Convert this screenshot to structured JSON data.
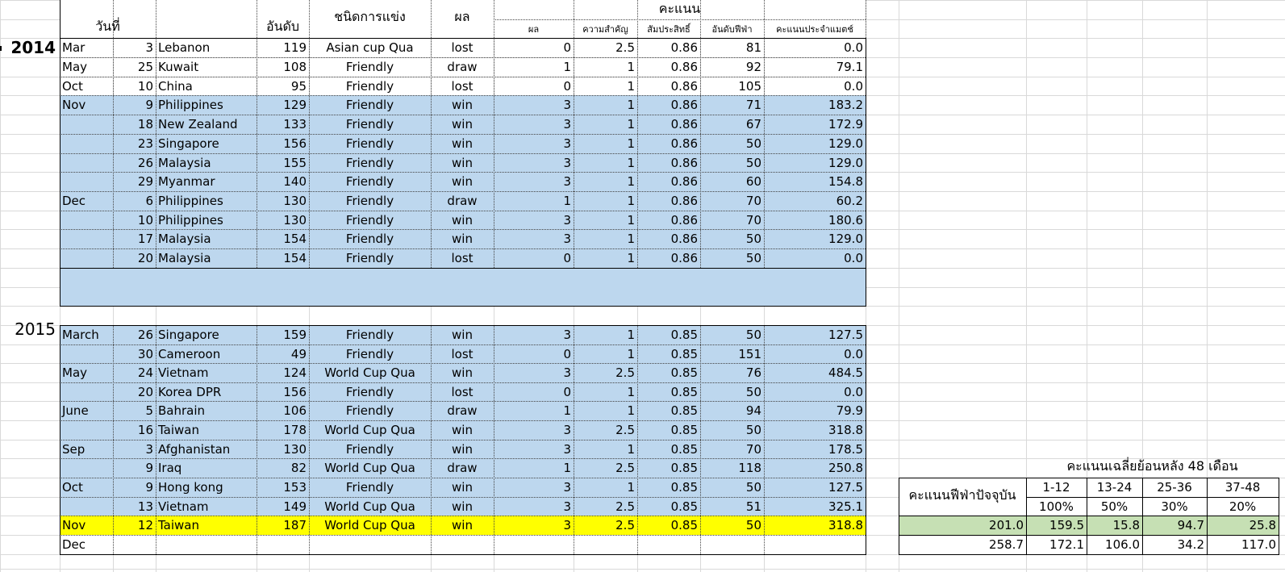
{
  "header": {
    "day": "วันที่",
    "rank": "อันดับ",
    "competition": "ชนิดการแข่ง",
    "result": "ผล",
    "points": "คะแนน",
    "sub": [
      "ผล",
      "ความสำคัญ",
      "สัมประสิทธิ์",
      "อันดับฟีฟ่า",
      "คะแนนประจำแมตช์"
    ]
  },
  "years": [
    "2014",
    "2015"
  ],
  "rows2014": [
    [
      "Mar",
      "3",
      "Lebanon",
      "119",
      "Asian cup Qua",
      "lost",
      "0",
      "2.5",
      "0.86",
      "81",
      "0.0"
    ],
    [
      "May",
      "25",
      "Kuwait",
      "108",
      "Friendly",
      "draw",
      "1",
      "1",
      "0.86",
      "92",
      "79.1"
    ],
    [
      "Oct",
      "10",
      "China",
      "95",
      "Friendly",
      "lost",
      "0",
      "1",
      "0.86",
      "105",
      "0.0"
    ],
    [
      "Nov",
      "9",
      "Philippines",
      "129",
      "Friendly",
      "win",
      "3",
      "1",
      "0.86",
      "71",
      "183.2"
    ],
    [
      "",
      "18",
      "New Zealand",
      "133",
      "Friendly",
      "win",
      "3",
      "1",
      "0.86",
      "67",
      "172.9"
    ],
    [
      "",
      "23",
      "Singapore",
      "156",
      "Friendly",
      "win",
      "3",
      "1",
      "0.86",
      "50",
      "129.0"
    ],
    [
      "",
      "26",
      "Malaysia",
      "155",
      "Friendly",
      "win",
      "3",
      "1",
      "0.86",
      "50",
      "129.0"
    ],
    [
      "",
      "29",
      "Myanmar",
      "140",
      "Friendly",
      "win",
      "3",
      "1",
      "0.86",
      "60",
      "154.8"
    ],
    [
      "Dec",
      "6",
      "Philippines",
      "130",
      "Friendly",
      "draw",
      "1",
      "1",
      "0.86",
      "70",
      "60.2"
    ],
    [
      "",
      "10",
      "Philippines",
      "130",
      "Friendly",
      "win",
      "3",
      "1",
      "0.86",
      "70",
      "180.6"
    ],
    [
      "",
      "17",
      "Malaysia",
      "154",
      "Friendly",
      "win",
      "3",
      "1",
      "0.86",
      "50",
      "129.0"
    ],
    [
      "",
      "20",
      "Malaysia",
      "154",
      "Friendly",
      "lost",
      "0",
      "1",
      "0.86",
      "50",
      "0.0"
    ]
  ],
  "rows2015": [
    [
      "March",
      "26",
      "Singapore",
      "159",
      "Friendly",
      "win",
      "3",
      "1",
      "0.85",
      "50",
      "127.5"
    ],
    [
      "",
      "30",
      "Cameroon",
      "49",
      "Friendly",
      "lost",
      "0",
      "1",
      "0.85",
      "151",
      "0.0"
    ],
    [
      "May",
      "24",
      "Vietnam",
      "124",
      "World Cup Qua",
      "win",
      "3",
      "2.5",
      "0.85",
      "76",
      "484.5"
    ],
    [
      "",
      "20",
      "Korea DPR",
      "156",
      "Friendly",
      "lost",
      "0",
      "1",
      "0.85",
      "50",
      "0.0"
    ],
    [
      "June",
      "5",
      "Bahrain",
      "106",
      "Friendly",
      "draw",
      "1",
      "1",
      "0.85",
      "94",
      "79.9"
    ],
    [
      "",
      "16",
      "Taiwan",
      "178",
      "World Cup Qua",
      "win",
      "3",
      "2.5",
      "0.85",
      "50",
      "318.8"
    ],
    [
      "Sep",
      "3",
      "Afghanistan",
      "130",
      "Friendly",
      "win",
      "3",
      "1",
      "0.85",
      "70",
      "178.5"
    ],
    [
      "",
      "9",
      "Iraq",
      "82",
      "World Cup Qua",
      "draw",
      "1",
      "2.5",
      "0.85",
      "118",
      "250.8"
    ],
    [
      "Oct",
      "9",
      "Hong kong",
      "153",
      "Friendly",
      "win",
      "3",
      "1",
      "0.85",
      "50",
      "127.5"
    ],
    [
      "",
      "13",
      "Vietnam",
      "149",
      "World Cup Qua",
      "win",
      "3",
      "2.5",
      "0.85",
      "51",
      "325.1"
    ],
    [
      "Nov",
      "12",
      "Taiwan",
      "187",
      "World Cup Qua",
      "win",
      "3",
      "2.5",
      "0.85",
      "50",
      "318.8"
    ],
    [
      "Dec",
      "",
      "",
      "",
      "",
      "",
      "",
      "",
      "",
      "",
      ""
    ]
  ],
  "summary": {
    "title": "คะแนนเฉลี่ยย้อนหลัง 48 เดือน",
    "current_label": "คะแนนฟีฟ่าปัจจุบัน",
    "periods": [
      "1-12",
      "13-24",
      "25-36",
      "37-48"
    ],
    "weights": [
      "100%",
      "50%",
      "30%",
      "20%"
    ],
    "row1": [
      "201.0",
      "159.5",
      "15.8",
      "94.7",
      "25.8"
    ],
    "row2": [
      "258.7",
      "172.1",
      "106.0",
      "34.2",
      "117.0"
    ]
  },
  "colors": {
    "blue": "#bdd7ee",
    "yellow": "#ffff00",
    "green": "#c6e0b4"
  }
}
